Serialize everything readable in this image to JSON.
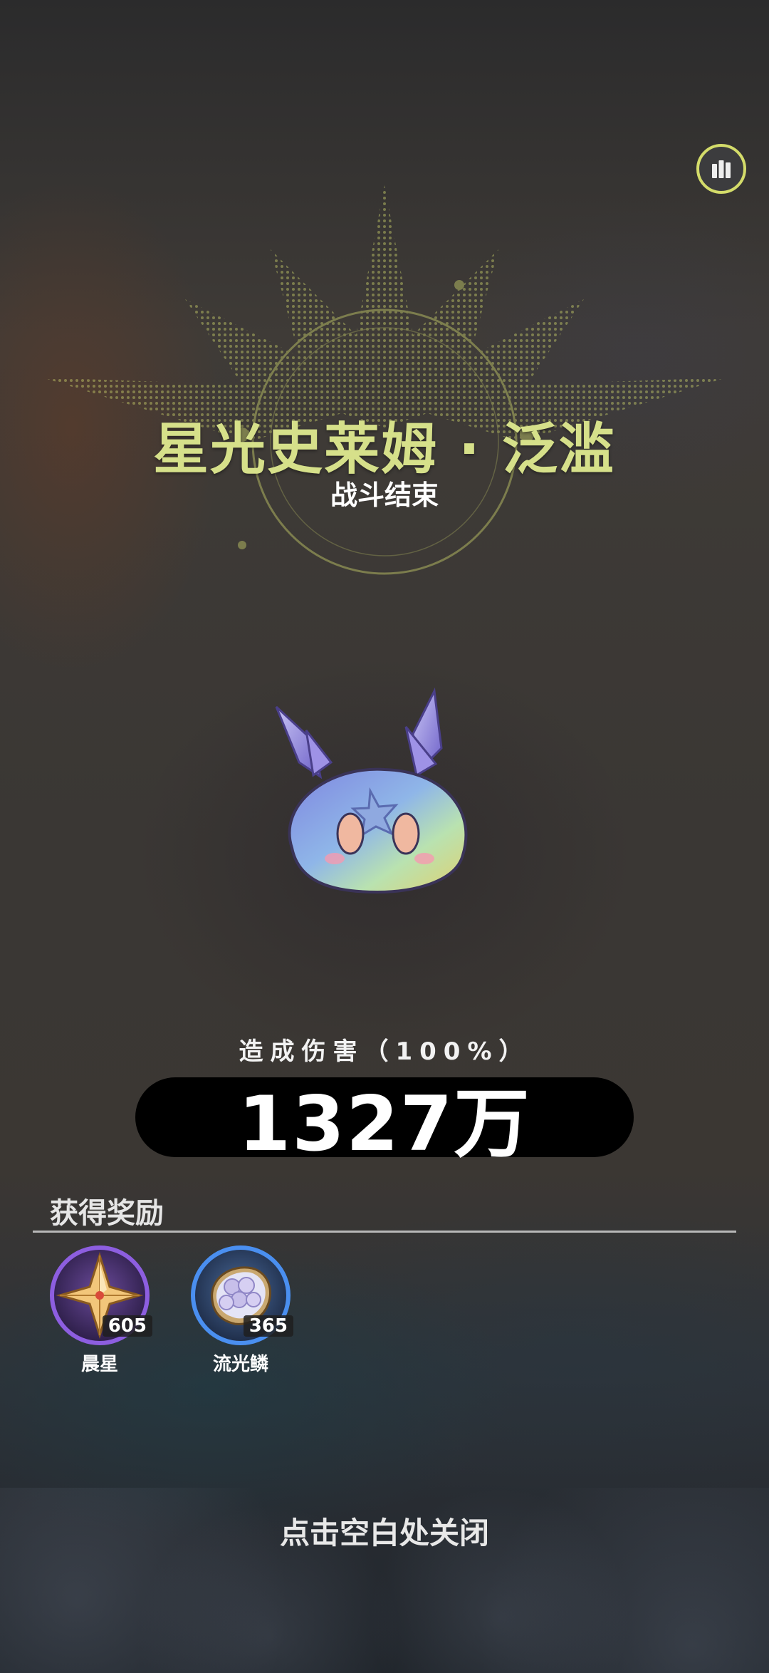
{
  "boss": {
    "title": "星光史莱姆 · 泛滥",
    "status": "战斗结束"
  },
  "damage": {
    "label": "造成伤害（100%）",
    "value": "1327万"
  },
  "rewards": {
    "title": "获得奖励",
    "items": [
      {
        "name": "晨星",
        "count": "605",
        "icon": "morning-star-crystal-icon",
        "ring_color": "#8d5ee0"
      },
      {
        "name": "流光鳞",
        "count": "365",
        "icon": "shimmer-scale-icon",
        "ring_color": "#4a8ff0"
      }
    ]
  },
  "footer": {
    "close_hint": "点击空白处关闭"
  },
  "colors": {
    "title_accent": "#d6e08a",
    "stats_button_ring": "#d4dc6a"
  }
}
